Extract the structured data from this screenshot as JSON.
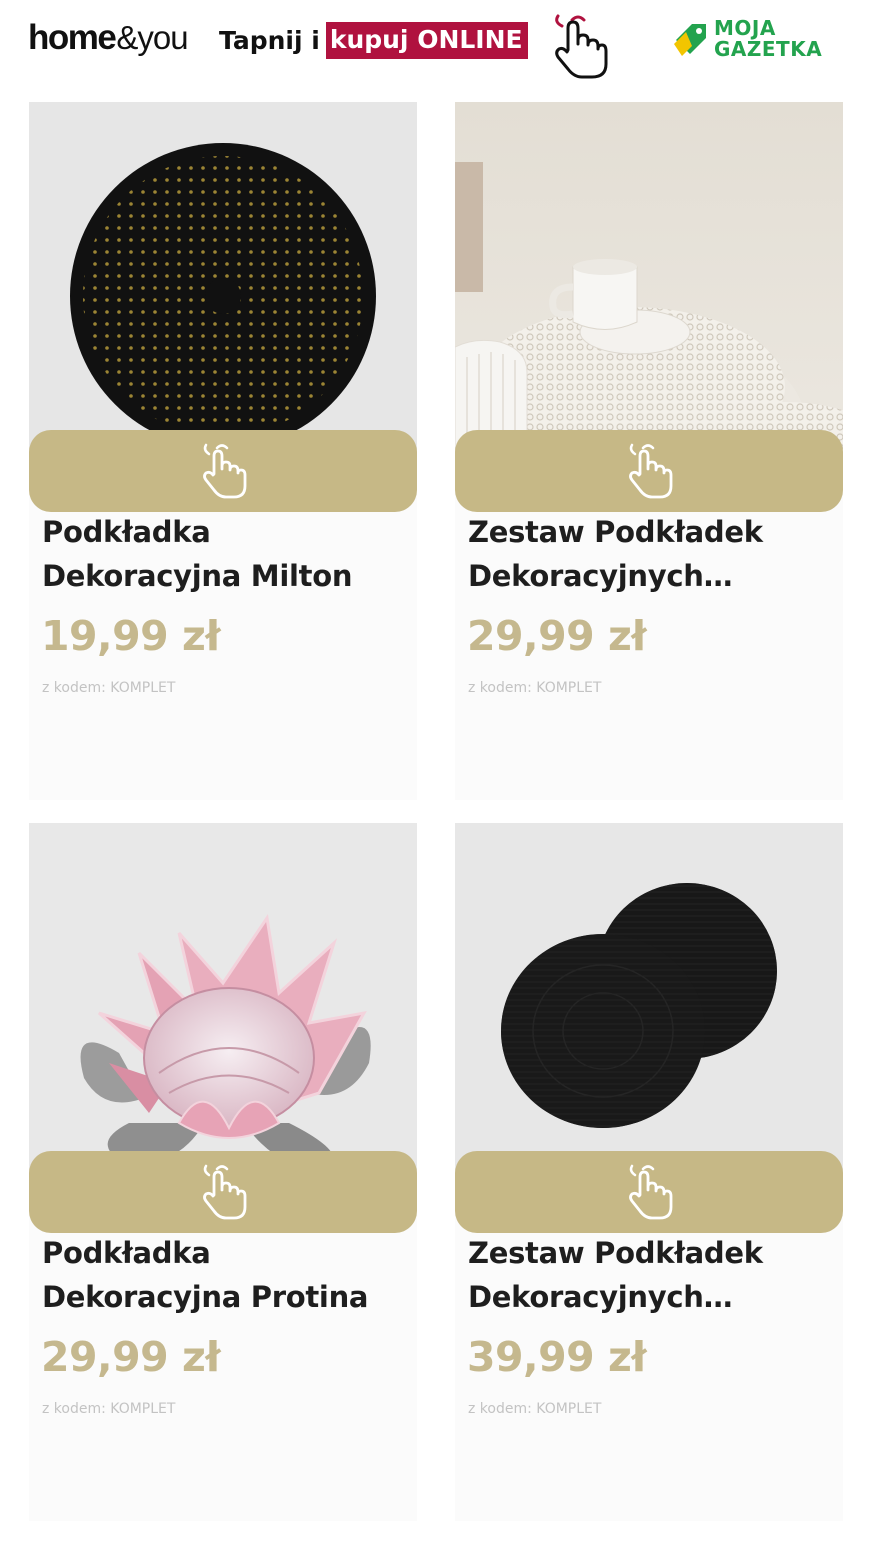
{
  "header": {
    "brand_home": "home",
    "brand_you": "&you",
    "cta_text": "Tapnij i",
    "cta_highlight": "kupuj ONLINE",
    "cta_icon": "tap-hand-icon",
    "logo_line1": "MOJA",
    "logo_line2": "GAZETKA",
    "logo_icon": "price-tag-icon"
  },
  "colors": {
    "accent_red": "#b0123f",
    "button_gold": "#c6b886",
    "price_gold": "#c5b88e",
    "logo_green": "#23a34e"
  },
  "products": [
    {
      "title": "Podkładka Dekoracyjna Milton",
      "price": "19,99 zł",
      "code": "z kodem: KOMPLET",
      "image": "black-round-placemat-with-gold-dots",
      "button_icon": "tap-hand-icon"
    },
    {
      "title": "Zestaw Podkładek Dekoracyjnych Menin...",
      "price": "29,99 zł",
      "code": "z kodem: KOMPLET",
      "image": "white-lace-placemat-with-cup",
      "button_icon": "tap-hand-icon"
    },
    {
      "title": "Podkładka Dekoracyjna Protina",
      "price": "29,99 zł",
      "code": "z kodem: KOMPLET",
      "image": "pink-protea-flower-placemat",
      "button_icon": "tap-hand-icon"
    },
    {
      "title": "Zestaw Podkładek Dekoracyjnych Glitter...",
      "price": "39,99 zł",
      "code": "z kodem: KOMPLET",
      "image": "two-black-round-placemats",
      "button_icon": "tap-hand-icon"
    }
  ]
}
